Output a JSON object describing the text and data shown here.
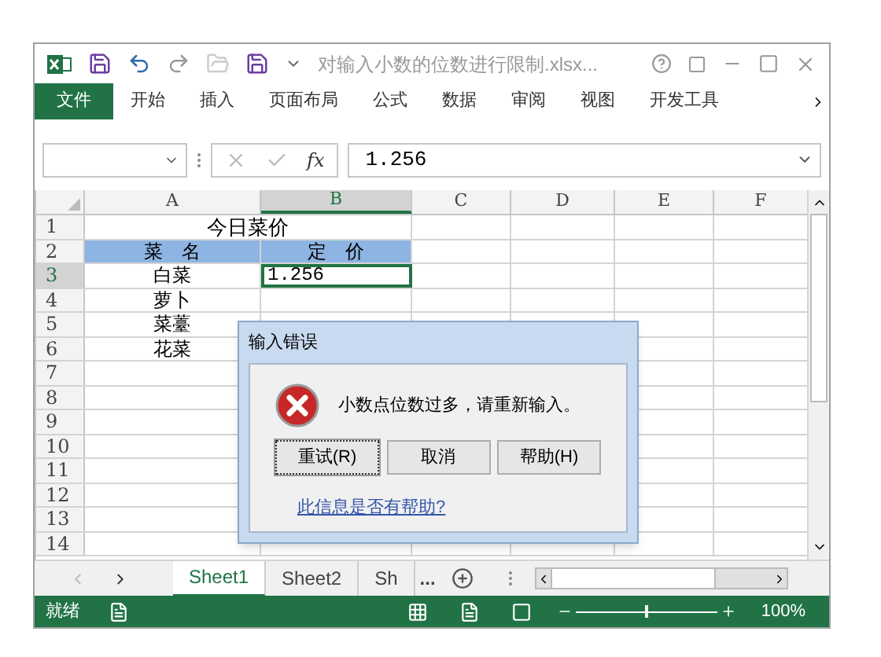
{
  "window": {
    "title": "对输入小数的位数进行限制.xlsx..."
  },
  "ribbon_tabs": [
    {
      "label": "文件",
      "selected": true
    },
    {
      "label": "开始",
      "selected": false
    },
    {
      "label": "插入",
      "selected": false
    },
    {
      "label": "页面布局",
      "selected": false
    },
    {
      "label": "公式",
      "selected": false
    },
    {
      "label": "数据",
      "selected": false
    },
    {
      "label": "审阅",
      "selected": false
    },
    {
      "label": "视图",
      "selected": false
    },
    {
      "label": "开发工具",
      "selected": false
    }
  ],
  "formula_bar": {
    "function_label": "fx",
    "value": "1.256"
  },
  "columns": [
    {
      "label": "A",
      "selected": false
    },
    {
      "label": "B",
      "selected": true
    },
    {
      "label": "C",
      "selected": false
    },
    {
      "label": "D",
      "selected": false
    },
    {
      "label": "E",
      "selected": false
    },
    {
      "label": "F",
      "selected": false
    }
  ],
  "rows": [
    {
      "label": "1",
      "selected": false,
      "kind": "title",
      "cells": [
        {
          "text": "今日菜价",
          "selected": false
        }
      ]
    },
    {
      "label": "2",
      "selected": false,
      "kind": "header",
      "cells": [
        {
          "text": "菜　名",
          "selected": false
        },
        {
          "text": "定　价",
          "selected": false
        }
      ]
    },
    {
      "label": "3",
      "selected": true,
      "kind": "data",
      "cells": [
        {
          "text": "白菜",
          "selected": false
        },
        {
          "text": "1.256",
          "selected": true
        }
      ]
    },
    {
      "label": "4",
      "selected": false,
      "kind": "data",
      "cells": [
        {
          "text": "萝卜",
          "selected": false
        }
      ]
    },
    {
      "label": "5",
      "selected": false,
      "kind": "data",
      "cells": [
        {
          "text": "菜薹",
          "selected": false
        }
      ]
    },
    {
      "label": "6",
      "selected": false,
      "kind": "data",
      "cells": [
        {
          "text": "花菜",
          "selected": false
        }
      ]
    },
    {
      "label": "7",
      "selected": false,
      "kind": "data"
    },
    {
      "label": "8",
      "selected": false,
      "kind": "data"
    },
    {
      "label": "9",
      "selected": false,
      "kind": "data"
    },
    {
      "label": "10",
      "selected": false,
      "kind": "data"
    },
    {
      "label": "11",
      "selected": false,
      "kind": "data"
    },
    {
      "label": "12",
      "selected": false,
      "kind": "data"
    },
    {
      "label": "13",
      "selected": false,
      "kind": "data"
    },
    {
      "label": "14",
      "selected": false,
      "kind": "data"
    }
  ],
  "dialog": {
    "title": "输入错误",
    "message": "小数点位数过多，请重新输入。",
    "buttons": [
      {
        "label": "重试(R)",
        "focused": true
      },
      {
        "label": "取消",
        "focused": false
      },
      {
        "label": "帮助(H)",
        "focused": false
      }
    ],
    "link": "此信息是否有帮助?"
  },
  "sheet_tabs": [
    {
      "label": "Sheet1",
      "selected": true
    },
    {
      "label": "Sheet2",
      "selected": false
    },
    {
      "label": "Sh",
      "selected": false
    }
  ],
  "sheet_tabs_more": "...",
  "status_bar": {
    "status": "就绪",
    "zoom": {
      "level": 0.5,
      "reading": "100%"
    }
  }
}
